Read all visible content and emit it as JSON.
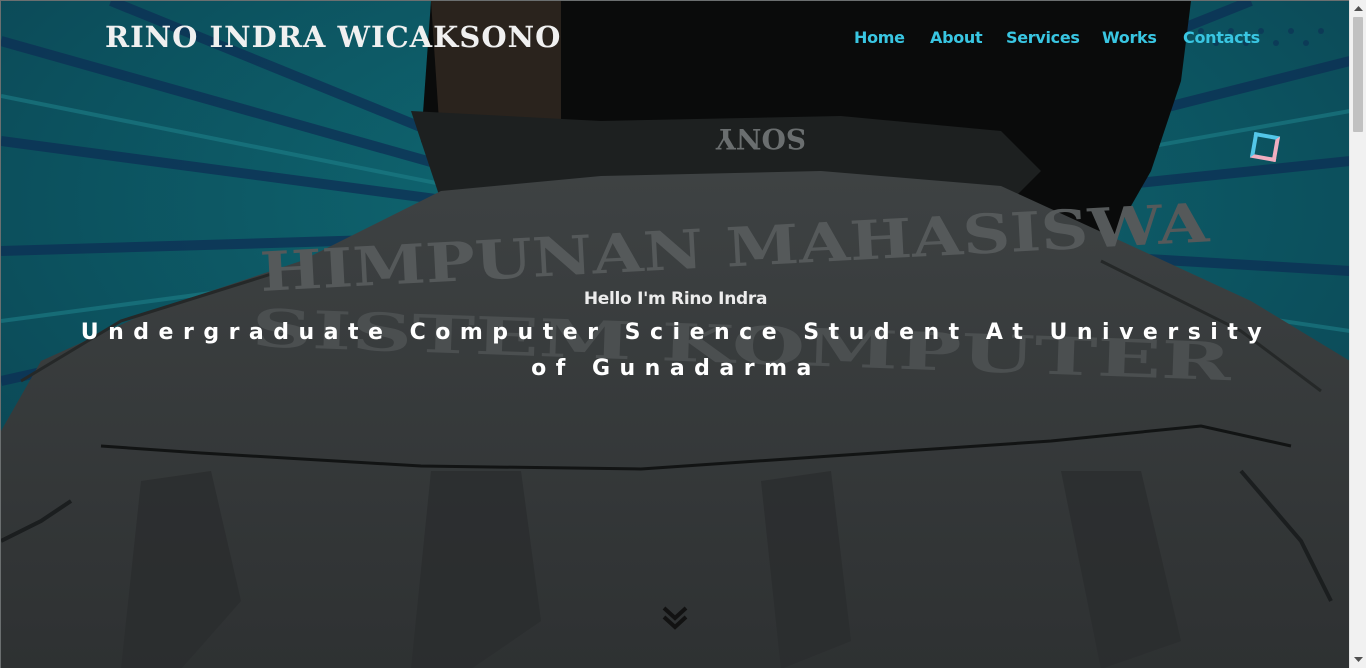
{
  "header": {
    "brand": "RINO INDRA WICAKSONO",
    "nav": [
      {
        "label": "Home"
      },
      {
        "label": "About"
      },
      {
        "label": "Services"
      },
      {
        "label": "Works"
      },
      {
        "label": "Contacts"
      }
    ]
  },
  "hero": {
    "greeting": "Hello I'm Rino Indra",
    "tagline": "Undergraduate Computer Science Student At University of Gunadarma",
    "background_image": {
      "jacket_print": [
        "HIMPUNAN MAHASISWA",
        "SISTEM KOMPUTER"
      ],
      "collar_print": "SONY"
    },
    "scroll_icon": "double-chevron-down-icon",
    "decor_icon": "outline-square-icon"
  },
  "colors": {
    "nav_link": "#39c6e2",
    "brand_text": "#f0f0f0",
    "background_teal": "#0d5260",
    "jacket": "#3a3d3e"
  }
}
